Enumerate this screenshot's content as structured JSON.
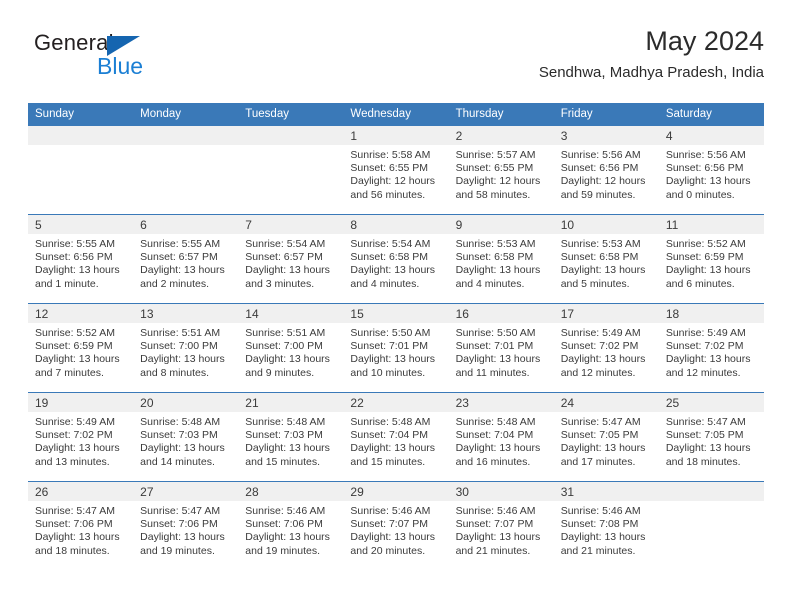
{
  "brand": {
    "name_part1": "General",
    "name_part2": "Blue",
    "flag_color": "#1565b0",
    "blue_color": "#1b7fd4"
  },
  "header": {
    "title": "May 2024",
    "subtitle": "Sendhwa, Madhya Pradesh, India"
  },
  "theme": {
    "header_blue": "#3a79b8",
    "day_band_gray": "#f0f0f0",
    "text_color": "#3b3b3b"
  },
  "weekdays": [
    "Sunday",
    "Monday",
    "Tuesday",
    "Wednesday",
    "Thursday",
    "Friday",
    "Saturday"
  ],
  "weeks": [
    [
      {
        "day": "",
        "lines": []
      },
      {
        "day": "",
        "lines": []
      },
      {
        "day": "",
        "lines": []
      },
      {
        "day": "1",
        "lines": [
          "Sunrise: 5:58 AM",
          "Sunset: 6:55 PM",
          "Daylight: 12 hours",
          "and 56 minutes."
        ]
      },
      {
        "day": "2",
        "lines": [
          "Sunrise: 5:57 AM",
          "Sunset: 6:55 PM",
          "Daylight: 12 hours",
          "and 58 minutes."
        ]
      },
      {
        "day": "3",
        "lines": [
          "Sunrise: 5:56 AM",
          "Sunset: 6:56 PM",
          "Daylight: 12 hours",
          "and 59 minutes."
        ]
      },
      {
        "day": "4",
        "lines": [
          "Sunrise: 5:56 AM",
          "Sunset: 6:56 PM",
          "Daylight: 13 hours",
          "and 0 minutes."
        ]
      }
    ],
    [
      {
        "day": "5",
        "lines": [
          "Sunrise: 5:55 AM",
          "Sunset: 6:56 PM",
          "Daylight: 13 hours",
          "and 1 minute."
        ]
      },
      {
        "day": "6",
        "lines": [
          "Sunrise: 5:55 AM",
          "Sunset: 6:57 PM",
          "Daylight: 13 hours",
          "and 2 minutes."
        ]
      },
      {
        "day": "7",
        "lines": [
          "Sunrise: 5:54 AM",
          "Sunset: 6:57 PM",
          "Daylight: 13 hours",
          "and 3 minutes."
        ]
      },
      {
        "day": "8",
        "lines": [
          "Sunrise: 5:54 AM",
          "Sunset: 6:58 PM",
          "Daylight: 13 hours",
          "and 4 minutes."
        ]
      },
      {
        "day": "9",
        "lines": [
          "Sunrise: 5:53 AM",
          "Sunset: 6:58 PM",
          "Daylight: 13 hours",
          "and 4 minutes."
        ]
      },
      {
        "day": "10",
        "lines": [
          "Sunrise: 5:53 AM",
          "Sunset: 6:58 PM",
          "Daylight: 13 hours",
          "and 5 minutes."
        ]
      },
      {
        "day": "11",
        "lines": [
          "Sunrise: 5:52 AM",
          "Sunset: 6:59 PM",
          "Daylight: 13 hours",
          "and 6 minutes."
        ]
      }
    ],
    [
      {
        "day": "12",
        "lines": [
          "Sunrise: 5:52 AM",
          "Sunset: 6:59 PM",
          "Daylight: 13 hours",
          "and 7 minutes."
        ]
      },
      {
        "day": "13",
        "lines": [
          "Sunrise: 5:51 AM",
          "Sunset: 7:00 PM",
          "Daylight: 13 hours",
          "and 8 minutes."
        ]
      },
      {
        "day": "14",
        "lines": [
          "Sunrise: 5:51 AM",
          "Sunset: 7:00 PM",
          "Daylight: 13 hours",
          "and 9 minutes."
        ]
      },
      {
        "day": "15",
        "lines": [
          "Sunrise: 5:50 AM",
          "Sunset: 7:01 PM",
          "Daylight: 13 hours",
          "and 10 minutes."
        ]
      },
      {
        "day": "16",
        "lines": [
          "Sunrise: 5:50 AM",
          "Sunset: 7:01 PM",
          "Daylight: 13 hours",
          "and 11 minutes."
        ]
      },
      {
        "day": "17",
        "lines": [
          "Sunrise: 5:49 AM",
          "Sunset: 7:02 PM",
          "Daylight: 13 hours",
          "and 12 minutes."
        ]
      },
      {
        "day": "18",
        "lines": [
          "Sunrise: 5:49 AM",
          "Sunset: 7:02 PM",
          "Daylight: 13 hours",
          "and 12 minutes."
        ]
      }
    ],
    [
      {
        "day": "19",
        "lines": [
          "Sunrise: 5:49 AM",
          "Sunset: 7:02 PM",
          "Daylight: 13 hours",
          "and 13 minutes."
        ]
      },
      {
        "day": "20",
        "lines": [
          "Sunrise: 5:48 AM",
          "Sunset: 7:03 PM",
          "Daylight: 13 hours",
          "and 14 minutes."
        ]
      },
      {
        "day": "21",
        "lines": [
          "Sunrise: 5:48 AM",
          "Sunset: 7:03 PM",
          "Daylight: 13 hours",
          "and 15 minutes."
        ]
      },
      {
        "day": "22",
        "lines": [
          "Sunrise: 5:48 AM",
          "Sunset: 7:04 PM",
          "Daylight: 13 hours",
          "and 15 minutes."
        ]
      },
      {
        "day": "23",
        "lines": [
          "Sunrise: 5:48 AM",
          "Sunset: 7:04 PM",
          "Daylight: 13 hours",
          "and 16 minutes."
        ]
      },
      {
        "day": "24",
        "lines": [
          "Sunrise: 5:47 AM",
          "Sunset: 7:05 PM",
          "Daylight: 13 hours",
          "and 17 minutes."
        ]
      },
      {
        "day": "25",
        "lines": [
          "Sunrise: 5:47 AM",
          "Sunset: 7:05 PM",
          "Daylight: 13 hours",
          "and 18 minutes."
        ]
      }
    ],
    [
      {
        "day": "26",
        "lines": [
          "Sunrise: 5:47 AM",
          "Sunset: 7:06 PM",
          "Daylight: 13 hours",
          "and 18 minutes."
        ]
      },
      {
        "day": "27",
        "lines": [
          "Sunrise: 5:47 AM",
          "Sunset: 7:06 PM",
          "Daylight: 13 hours",
          "and 19 minutes."
        ]
      },
      {
        "day": "28",
        "lines": [
          "Sunrise: 5:46 AM",
          "Sunset: 7:06 PM",
          "Daylight: 13 hours",
          "and 19 minutes."
        ]
      },
      {
        "day": "29",
        "lines": [
          "Sunrise: 5:46 AM",
          "Sunset: 7:07 PM",
          "Daylight: 13 hours",
          "and 20 minutes."
        ]
      },
      {
        "day": "30",
        "lines": [
          "Sunrise: 5:46 AM",
          "Sunset: 7:07 PM",
          "Daylight: 13 hours",
          "and 21 minutes."
        ]
      },
      {
        "day": "31",
        "lines": [
          "Sunrise: 5:46 AM",
          "Sunset: 7:08 PM",
          "Daylight: 13 hours",
          "and 21 minutes."
        ]
      },
      {
        "day": "",
        "lines": []
      }
    ]
  ]
}
